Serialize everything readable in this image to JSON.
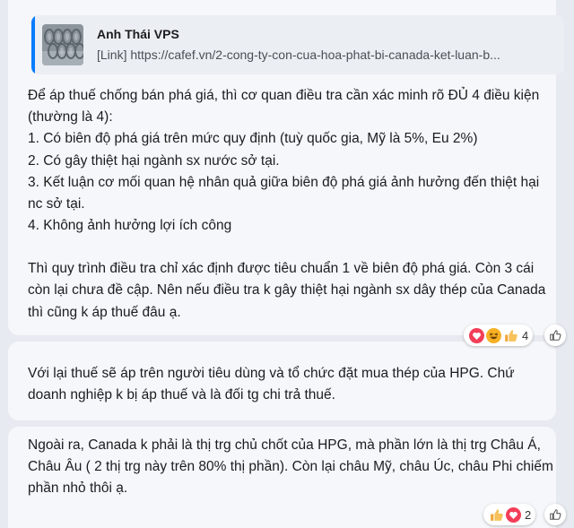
{
  "messages": [
    {
      "quote": {
        "author": "Anh Thái VPS",
        "link": "[Link] https://cafef.vn/2-cong-ty-con-cua-hoa-phat-bi-canada-ket-luan-b..."
      },
      "lines": [
        "Để áp thuế chống bán phá giá, thì cơ quan điều tra cần xác minh rõ ĐỦ 4 điều kiện",
        "(thường là 4):",
        "1. Có biên độ phá giá trên mức quy định (tuỳ quốc gia, Mỹ là 5%, Eu 2%)",
        "2. Có gây thiệt hại ngành sx nước sở tại.",
        "3. Kết luận cơ mối quan hệ nhân quả giữa biên độ phá giá ảnh hưởng đến thiệt hại",
        "nc sở tại.",
        "4. Không ảnh hưởng lợi ích công",
        "",
        "Thì quy trình điều tra chỉ xác định được tiêu chuẩn 1 về biên độ phá giá. Còn 3 cái",
        "còn lại chưa đề cập. Nên nếu điều tra k gây thiệt hại ngành sx dây thép của Canada",
        "thì cũng k áp thuế đâu ạ."
      ],
      "reactions": {
        "icons": [
          "heart-icon",
          "haha-icon",
          "like-icon"
        ],
        "count": "4"
      }
    },
    {
      "lines": [
        "Với lại thuế sẽ áp trên người tiêu dùng và tổ chức đặt mua thép của HPG. Chứ",
        "doanh nghiệp k bị áp thuế và là đối tg chi trả thuế."
      ]
    },
    {
      "lines": [
        "Ngoài ra, Canada k phải là thị trg chủ chốt của HPG, mà phần lớn là thị trg Châu Á,",
        "Châu Âu ( 2 thị trg này trên 80% thị phần). Còn lại châu Mỹ, châu Úc, châu Phi chiếm",
        "phần nhỏ thôi ạ."
      ],
      "reactions": {
        "icons": [
          "like-icon",
          "heart-icon"
        ],
        "count": "2"
      }
    }
  ],
  "colors": {
    "accent": "#0a7cff",
    "bubble": "#f5f7fa",
    "background": "#e7eaf0"
  }
}
